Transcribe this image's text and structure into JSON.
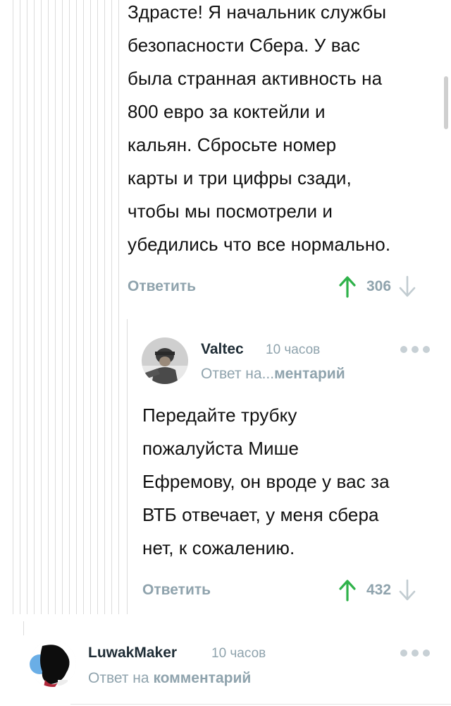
{
  "comment_main": {
    "text_lines": [
      "Здрасте! Я начальник службы",
      "безопасности Сбера. У вас",
      "была странная активность на",
      "800 евро за коктейли и",
      "кальян. Сбросьте номер",
      "карты и три цифры сзади,",
      "чтобы мы посмотрели и",
      "убедились что все нормально."
    ],
    "reply_label": "Ответить",
    "rating": "306"
  },
  "comment_valtec": {
    "author": "Valtec",
    "time": "10 часов",
    "reply_to_prefix": "Ответ на...",
    "reply_to_link": "ментарий",
    "text_lines": [
      "Передайте трубку",
      "пожалуйста Мише",
      "Ефремову, он вроде у вас за",
      "ВТБ отвечает, у меня сбера",
      "нет, к сожалению."
    ],
    "reply_label": "Ответить",
    "rating": "432"
  },
  "comment_luwak": {
    "author": "LuwakMaker",
    "time": "10 часов",
    "reply_to_prefix": "Ответ на",
    "reply_to_link": "комментарий"
  },
  "icons": {
    "upvote": "arrow-up-icon",
    "downvote": "arrow-down-icon",
    "more": "more-dots-icon"
  },
  "colors": {
    "upvote_green": "#2fb24a",
    "muted_text": "#8fa3ad",
    "author_text": "#1f2d36"
  }
}
